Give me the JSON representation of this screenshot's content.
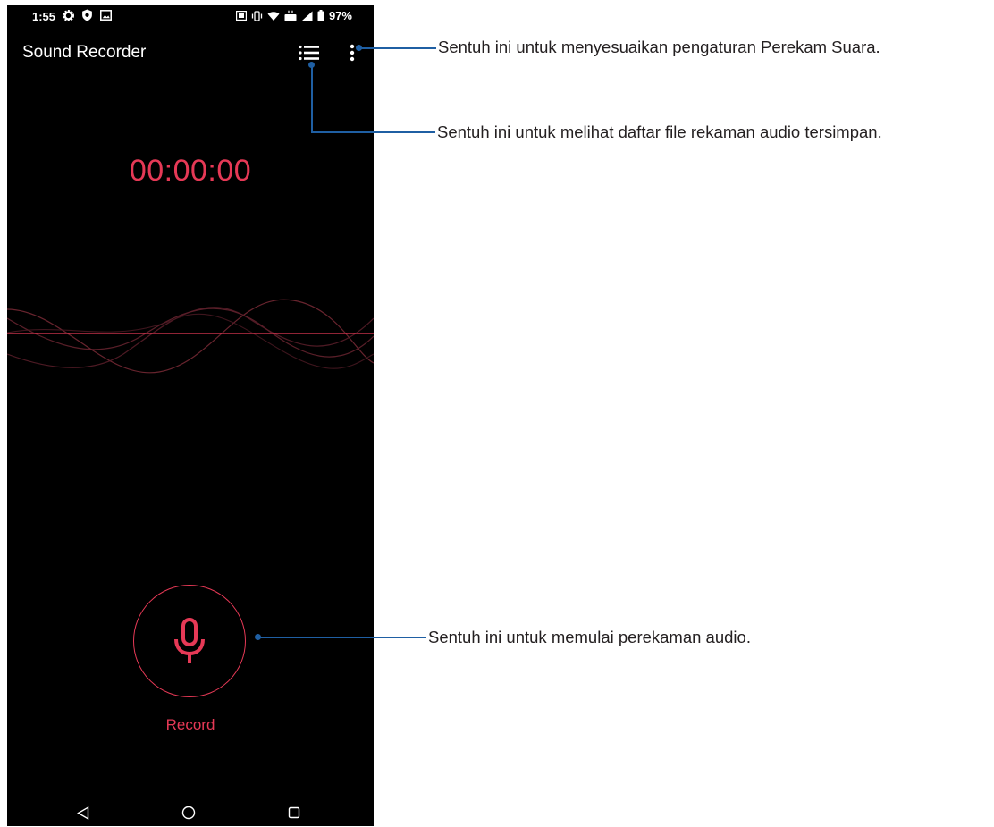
{
  "status_bar": {
    "time": "1:55",
    "battery": "97%",
    "left_icons": [
      "gear-icon",
      "shield-icon",
      "gallery-icon"
    ],
    "right_icons": [
      "nfc-icon",
      "vibrate-icon",
      "wifi-icon",
      "lte-icon",
      "signal-icon",
      "battery-icon"
    ]
  },
  "app": {
    "title": "Sound Recorder",
    "timer": "00:00:00",
    "record_label": "Record",
    "accent_color": "#e63956"
  },
  "toolbar": {
    "list_icon": "list-icon",
    "more_icon": "more-vert-icon"
  },
  "nav": {
    "back_icon": "back-triangle-icon",
    "home_icon": "home-circle-icon",
    "recents_icon": "recents-square-icon"
  },
  "callouts": {
    "settings": "Sentuh ini untuk menyesuaikan pengaturan Perekam Suara.",
    "list": "Sentuh ini untuk melihat daftar file rekaman audio tersimpan.",
    "record": "Sentuh ini untuk memulai perekaman audio.",
    "line_color": "#1f5fa3"
  }
}
